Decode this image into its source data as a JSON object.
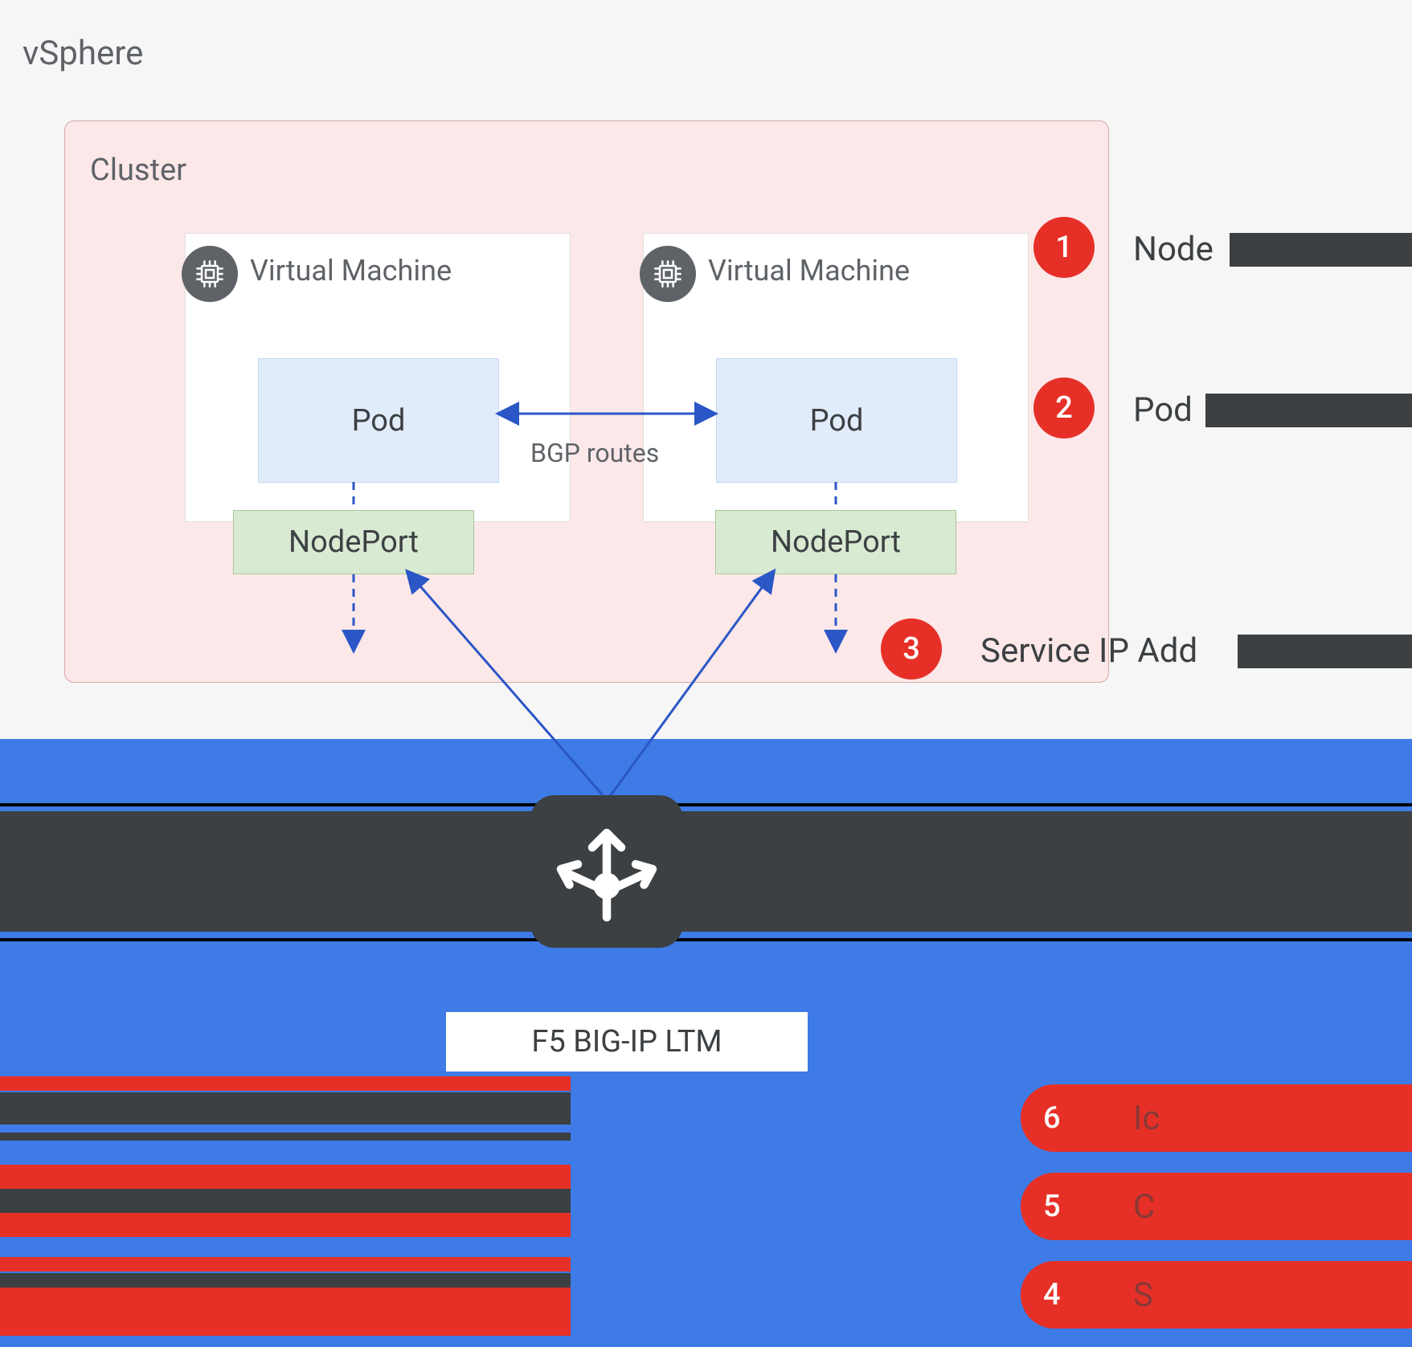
{
  "vsphere": {
    "label": "vSphere"
  },
  "cluster": {
    "label": "Cluster"
  },
  "vm": {
    "label": "Virtual Machine",
    "pod_label": "Pod",
    "nodeport_label": "NodePort",
    "bgp_label": "BGP routes"
  },
  "loadbalancer": {
    "label": "F5 BIG-IP LTM"
  },
  "annotations": {
    "a1": {
      "num": "1",
      "text": "Node"
    },
    "a2": {
      "num": "2",
      "text": "Pod"
    },
    "a3": {
      "num": "3",
      "text": "Service IP Add"
    },
    "a4": {
      "num": "4",
      "text": "S"
    },
    "a5": {
      "num": "5",
      "text": "C"
    },
    "a6": {
      "num": "6",
      "text": "Ic"
    }
  }
}
